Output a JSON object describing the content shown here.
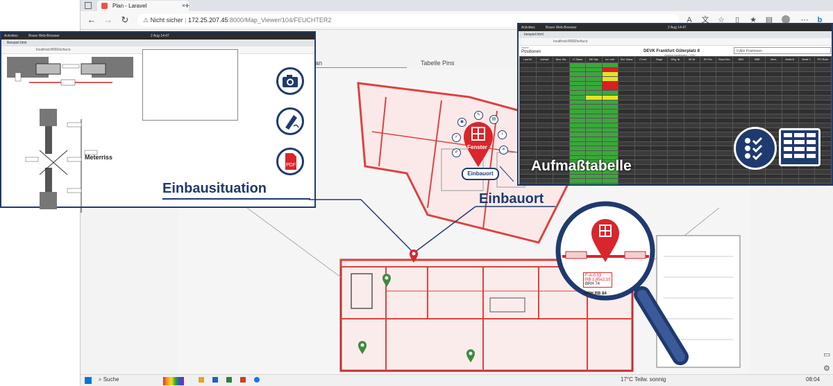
{
  "main_browser": {
    "tab_title": "Plan - Laravel",
    "new_tab": "+",
    "security_label": "Nicht sicher",
    "url_host": "172.25.207.45",
    "url_rest": ":8000/Map_Viewer/104/FEUCHTER2",
    "view_tab_active": "an",
    "view_tab_2": "Tabelle Pins"
  },
  "left_popup": {
    "top_left": "Activities",
    "app_name": "Brave Web-Browser",
    "time": "2 Aug 14:47",
    "tab_title": "Beispiel.html",
    "url": "localhost:8000/schuco",
    "measure_label": "Meterriss",
    "caption": "Einbausituation"
  },
  "pin": {
    "label": "Fenster",
    "badge": "Einbauort"
  },
  "einbauort_label": "Einbauort",
  "aufmass_label": "Aufmaßtabelle",
  "right_popup": {
    "top_left": "Activities",
    "app_name": "Brave Web-Browser",
    "time": "2 Aug 14:47",
    "tab_title": "beispiel.html",
    "url": "localhost:8000/schuco",
    "breadcrumb": "Home",
    "heading": "Positionen",
    "project": "DEVK Frankfurt Güterplatz 8",
    "filter_placeholder": "0 Alle Positionen",
    "sub_link": "+ Position anlegen",
    "subtitle": "Ansicht bearbeiten / CSV",
    "columns": [
      "Lauf.Nr.",
      "Aufmaß",
      "Best. Sta.",
      "LT Status",
      "WE Stat.",
      "Inv. vorh.",
      "Einl. Status",
      "LT Inst.",
      "Etage",
      "Whg. Nr.",
      "GE Nr.",
      "ED Pos.",
      "Raum Bez.",
      "RBH",
      "RBR",
      "Oberl.",
      "Breite B.",
      "Breite T.",
      "TFH Rohb."
    ]
  },
  "magnifier": {
    "code": "F-A-0.03",
    "rb_label": "RB",
    "rb_value": "1,85x2,10",
    "brh_label": "BRH",
    "brh_value": "74",
    "footer": "BRH RB 84"
  },
  "taskbar": {
    "search": "Suche",
    "temperature": "17°C",
    "weather": "Teilw. sonnig",
    "time": "08:04"
  },
  "colors": {
    "navy": "#1f3a6e",
    "pin_red": "#d8262c",
    "pin_green": "#3d8b3d",
    "table_green": "#3aa83a",
    "table_yellow": "#e8e02a",
    "table_red": "#d92020"
  }
}
